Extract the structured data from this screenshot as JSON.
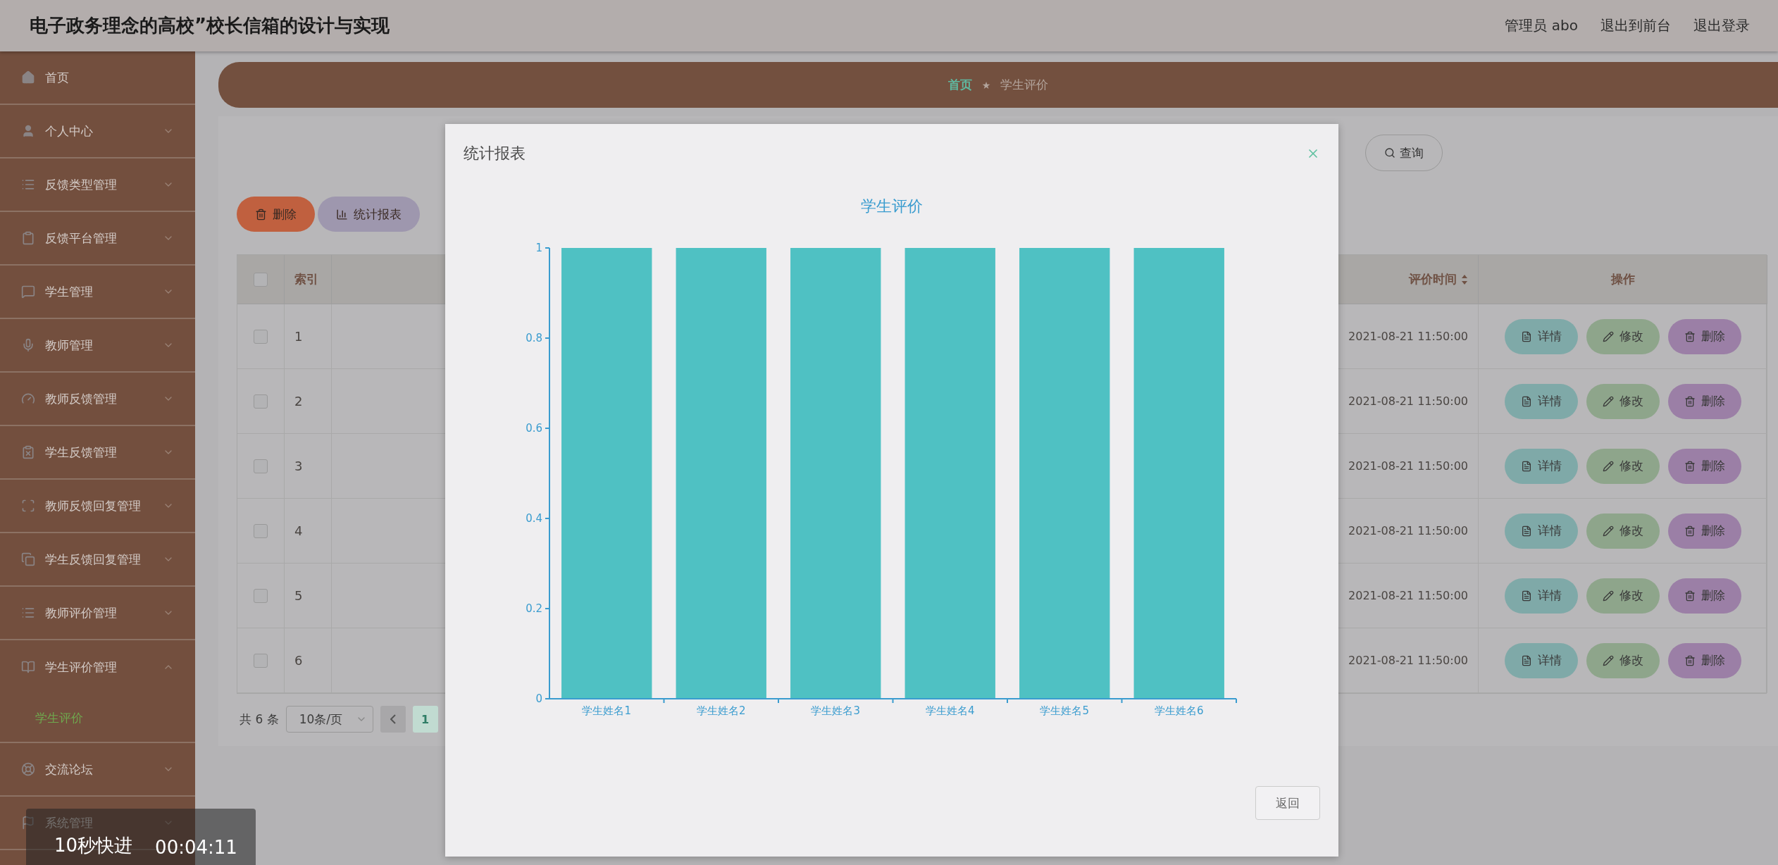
{
  "header": {
    "title": "电子政务理念的高校”校长信箱的设计与实现",
    "links": [
      "管理员 abo",
      "退出到前台",
      "退出登录"
    ]
  },
  "sidebar": {
    "items": [
      {
        "label": "首页",
        "kind": "link"
      },
      {
        "label": "个人中心",
        "kind": "menu",
        "expanded": false
      },
      {
        "label": "反馈类型管理",
        "kind": "menu",
        "expanded": false
      },
      {
        "label": "反馈平台管理",
        "kind": "menu",
        "expanded": false
      },
      {
        "label": "学生管理",
        "kind": "menu",
        "expanded": false
      },
      {
        "label": "教师管理",
        "kind": "menu",
        "expanded": false
      },
      {
        "label": "教师反馈管理",
        "kind": "menu",
        "expanded": false
      },
      {
        "label": "学生反馈管理",
        "kind": "menu",
        "expanded": false
      },
      {
        "label": "教师反馈回复管理",
        "kind": "menu",
        "expanded": false
      },
      {
        "label": "学生反馈回复管理",
        "kind": "menu",
        "expanded": false
      },
      {
        "label": "教师评价管理",
        "kind": "menu",
        "expanded": false
      },
      {
        "label": "学生评价管理",
        "kind": "menu",
        "expanded": true,
        "children": [
          {
            "label": "学生评价",
            "selected": true
          }
        ]
      },
      {
        "label": "交流论坛",
        "kind": "menu",
        "expanded": false
      },
      {
        "label": "系统管理",
        "kind": "menu",
        "expanded": false
      }
    ]
  },
  "breadcrumb": {
    "items": [
      "首页",
      "学生评价"
    ],
    "separator": "★"
  },
  "search": {
    "button": "查询"
  },
  "actions": [
    {
      "kind": "delete",
      "label": "删除"
    },
    {
      "kind": "report",
      "label": "统计报表"
    }
  ],
  "table": {
    "all_checked": false,
    "columns": [
      {
        "label": "索引",
        "sortable": false
      },
      {
        "label": "评价时间",
        "sortable": true
      },
      {
        "label": "操作",
        "sortable": false
      }
    ],
    "rows": [
      {
        "checked": false,
        "index": "1",
        "time": "2021-08-21 11:50:00",
        "actions": [
          {
            "kind": "detail",
            "label": "详情"
          },
          {
            "kind": "edit",
            "label": "修改"
          },
          {
            "kind": "delete",
            "label": "删除"
          }
        ]
      },
      {
        "checked": false,
        "index": "2",
        "time": "2021-08-21 11:50:00",
        "actions": [
          {
            "kind": "detail",
            "label": "详情"
          },
          {
            "kind": "edit",
            "label": "修改"
          },
          {
            "kind": "delete",
            "label": "删除"
          }
        ]
      },
      {
        "checked": false,
        "index": "3",
        "time": "2021-08-21 11:50:00",
        "actions": [
          {
            "kind": "detail",
            "label": "详情"
          },
          {
            "kind": "edit",
            "label": "修改"
          },
          {
            "kind": "delete",
            "label": "删除"
          }
        ]
      },
      {
        "checked": false,
        "index": "4",
        "time": "2021-08-21 11:50:00",
        "actions": [
          {
            "kind": "detail",
            "label": "详情"
          },
          {
            "kind": "edit",
            "label": "修改"
          },
          {
            "kind": "delete",
            "label": "删除"
          }
        ]
      },
      {
        "checked": false,
        "index": "5",
        "time": "2021-08-21 11:50:00",
        "actions": [
          {
            "kind": "detail",
            "label": "详情"
          },
          {
            "kind": "edit",
            "label": "修改"
          },
          {
            "kind": "delete",
            "label": "删除"
          }
        ]
      },
      {
        "checked": false,
        "index": "6",
        "time": "2021-08-21 11:50:00",
        "actions": [
          {
            "kind": "detail",
            "label": "详情"
          },
          {
            "kind": "edit",
            "label": "修改"
          },
          {
            "kind": "delete",
            "label": "删除"
          }
        ]
      }
    ]
  },
  "pagination": {
    "total": "共 6 条",
    "page_size": "10条/页",
    "pages": [
      {
        "label": "1",
        "selected": true
      }
    ]
  },
  "modal": {
    "title": "统计报表",
    "back_button": "返回",
    "chart_data": {
      "type": "bar",
      "title": "学生评价",
      "categories": [
        "学生姓名1",
        "学生姓名2",
        "学生姓名3",
        "学生姓名4",
        "学生姓名5",
        "学生姓名6"
      ],
      "values": [
        1,
        1,
        1,
        1,
        1,
        1
      ],
      "ylim": [
        0,
        1
      ],
      "yticks": [
        0,
        0.2,
        0.4,
        0.6,
        0.8,
        1
      ]
    }
  },
  "video_overlay": {
    "label": "10秒快进",
    "time": "00:04:11"
  }
}
